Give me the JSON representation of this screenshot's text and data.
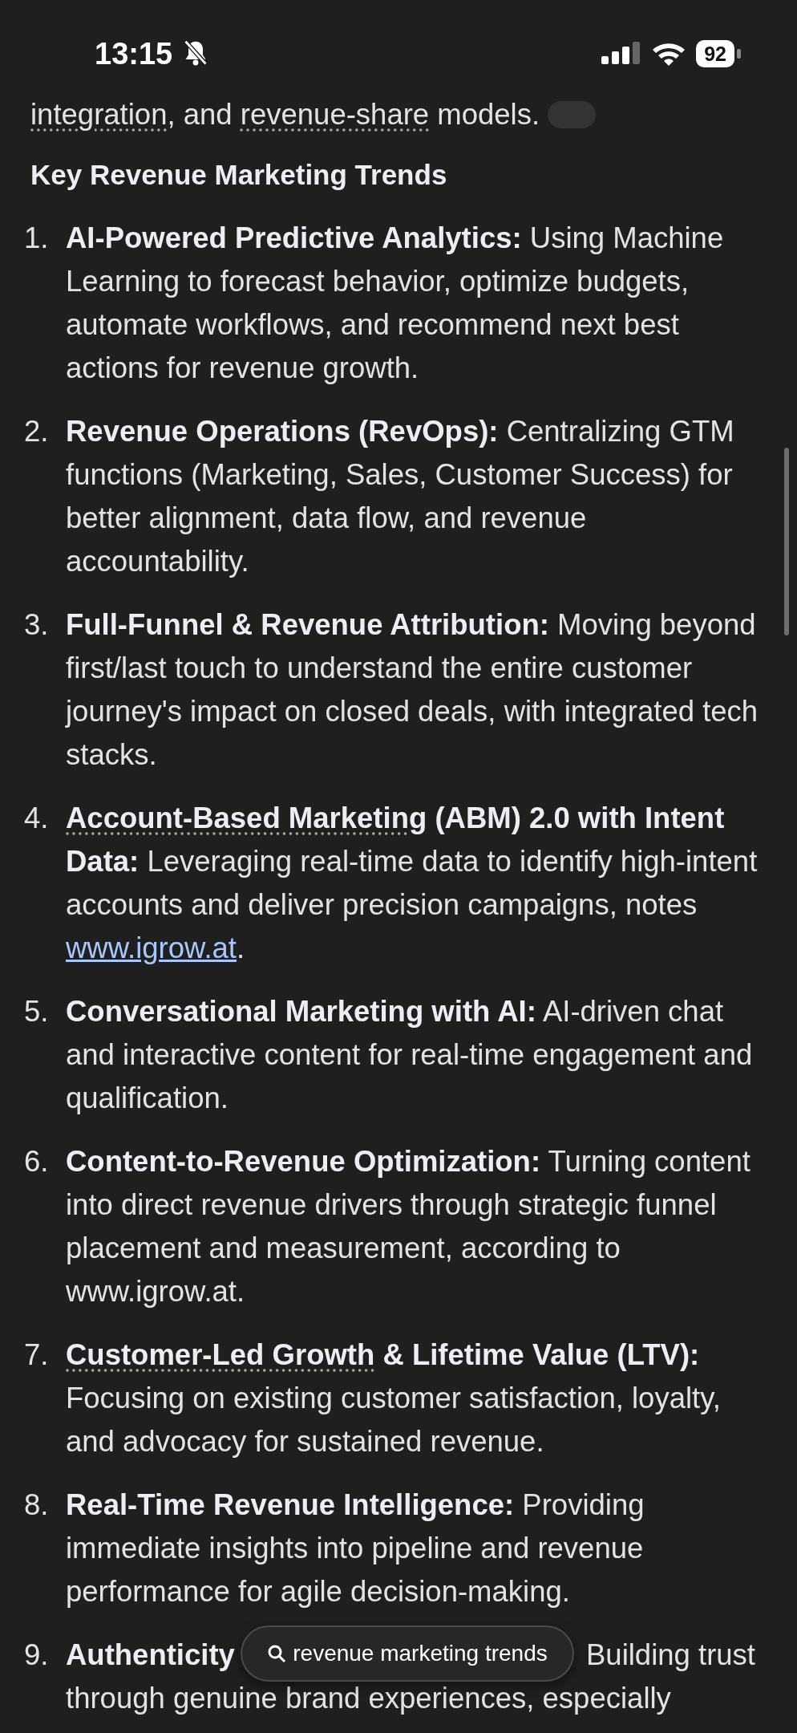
{
  "status_bar": {
    "time": "13:15",
    "battery": "92"
  },
  "intro_line": [
    {
      "text": "integration",
      "kind": "dotted"
    },
    {
      "text": ", and ",
      "kind": "plain"
    },
    {
      "text": "revenue-share",
      "kind": "dotted"
    },
    {
      "text": " models.",
      "kind": "plain"
    }
  ],
  "heading": "Key Revenue Marketing Trends",
  "items": [
    {
      "number": "1.",
      "parts": [
        {
          "text": "AI-Powered Predictive Analytics:",
          "kind": "bold"
        },
        {
          "text": " Using Machine Learning to forecast behavior, optimize budgets, automate workflows, and recommend next best actions for revenue growth.",
          "kind": "plain"
        }
      ]
    },
    {
      "number": "2.",
      "parts": [
        {
          "text": "Revenue Operations (RevOps):",
          "kind": "bold"
        },
        {
          "text": " Centralizing GTM functions (Marketing, Sales, Customer Success) for better alignment, data flow, and revenue accountability.",
          "kind": "plain"
        }
      ]
    },
    {
      "number": "3.",
      "parts": [
        {
          "text": "Full-Funnel & Revenue Attribution:",
          "kind": "bold"
        },
        {
          "text": " Moving beyond first/last touch to understand the entire customer journey's impact on closed deals, with integrated tech stacks.",
          "kind": "plain"
        }
      ]
    },
    {
      "number": "4.",
      "parts": [
        {
          "text": "Account-Based Marketing",
          "kind": "bolddotted"
        },
        {
          "text": " (ABM) 2.0 with Intent Data:",
          "kind": "bold"
        },
        {
          "text": " Leveraging real-time data to identify high-intent accounts and deliver precision campaigns, notes ",
          "kind": "plain"
        },
        {
          "text": "www.igrow.at",
          "kind": "link"
        },
        {
          "text": ".",
          "kind": "plain"
        }
      ]
    },
    {
      "number": "5.",
      "parts": [
        {
          "text": "Conversational Marketing with AI:",
          "kind": "bold"
        },
        {
          "text": " AI-driven chat and interactive content for real-time engagement and qualification.",
          "kind": "plain"
        }
      ]
    },
    {
      "number": "6.",
      "parts": [
        {
          "text": "Content-to-Revenue Optimization:",
          "kind": "bold"
        },
        {
          "text": " Turning content into direct revenue drivers through strategic funnel placement and measurement, according to www.igrow.at.",
          "kind": "plain"
        }
      ]
    },
    {
      "number": "7.",
      "parts": [
        {
          "text": "Customer-Led Growth",
          "kind": "bolddotted"
        },
        {
          "text": " & Lifetime Value (LTV):",
          "kind": "bold"
        },
        {
          "text": " Focusing on existing customer satisfaction, loyalty, and advocacy for sustained revenue.",
          "kind": "plain"
        }
      ]
    },
    {
      "number": "8.",
      "parts": [
        {
          "text": "Real-Time Revenue Intelligence:",
          "kind": "bold"
        },
        {
          "text": " Providing immediate insights into pipeline and revenue performance for agile decision-making.",
          "kind": "plain"
        }
      ]
    },
    {
      "number": "9.",
      "parts": [
        {
          "text": "Authenticity",
          "kind": "bold"
        },
        {
          "text": "Building trust",
          "kind": "covered"
        }
      ],
      "next_line": "through genuine brand experiences, especially"
    }
  ],
  "search_pill": {
    "query": "revenue marketing trends"
  }
}
